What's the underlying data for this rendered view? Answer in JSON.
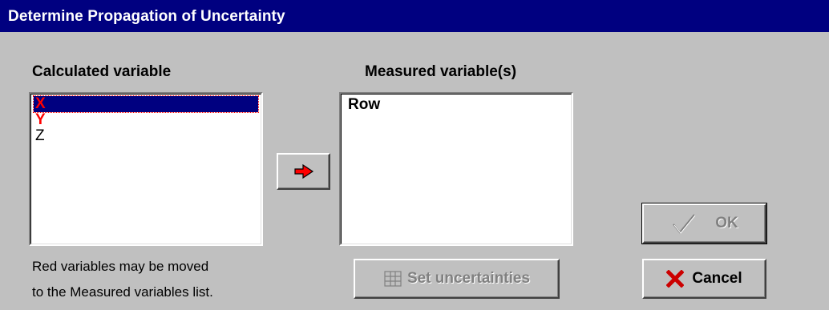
{
  "window": {
    "title": "Determine Propagation of Uncertainty"
  },
  "calculated": {
    "label": "Calculated variable",
    "items": [
      {
        "label": "X",
        "color": "#ff0000",
        "selected": true
      },
      {
        "label": "Y",
        "color": "#ff0000",
        "selected": false
      },
      {
        "label": "Z",
        "color": "#000000",
        "selected": false
      }
    ]
  },
  "measured": {
    "label": "Measured variable(s)",
    "items": [
      {
        "label": "Row"
      }
    ]
  },
  "move_button": {
    "icon": "red-arrow-right-icon"
  },
  "note": {
    "line1": "Red variables may be moved",
    "line2": "to the Measured variables list."
  },
  "buttons": {
    "set_uncertainties": {
      "label": "Set uncertainties",
      "enabled": false,
      "icon": "grid-icon"
    },
    "ok": {
      "label": "OK",
      "enabled": false,
      "icon": "checkmark-icon"
    },
    "cancel": {
      "label": "Cancel",
      "enabled": true,
      "icon": "red-x-icon"
    }
  },
  "colors": {
    "titlebar": "#000080",
    "face": "#c0c0c0",
    "accent_red": "#ff0000"
  }
}
